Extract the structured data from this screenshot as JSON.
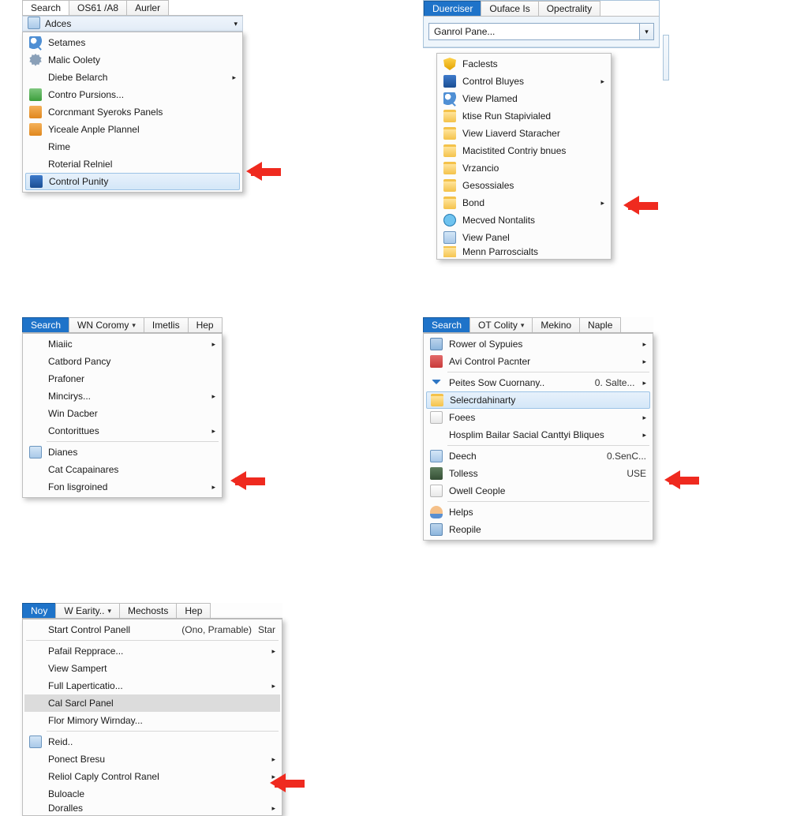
{
  "panel1": {
    "tabs": [
      "Search",
      "OS61 /A8",
      "Aurler"
    ],
    "subbar": {
      "label": "Adces"
    },
    "items": [
      {
        "label": "Setames",
        "icon": "search",
        "submenu": false
      },
      {
        "label": "Malic Oolety",
        "icon": "gear",
        "submenu": false
      },
      {
        "label": "Diebe Belarch",
        "icon": "",
        "submenu": true
      },
      {
        "label": "Contro Pursions...",
        "icon": "green",
        "submenu": false
      },
      {
        "label": "Corcnmant Syeroks Panels",
        "icon": "orange",
        "submenu": false
      },
      {
        "label": "Yiceale Anple Plannel",
        "icon": "orange",
        "submenu": false
      },
      {
        "label": "Rime",
        "icon": "",
        "submenu": false
      },
      {
        "label": "Roterial Relniel",
        "icon": "",
        "submenu": false
      },
      {
        "label": "Control Punity",
        "icon": "bluepc",
        "submenu": false,
        "highlight": "blue"
      }
    ]
  },
  "panel2": {
    "tabs": [
      "Duerciser",
      "Ouface Is",
      "Opectrality"
    ],
    "combo": "Ganrol Pane...",
    "items": [
      {
        "label": "Faclests",
        "icon": "shield",
        "submenu": false
      },
      {
        "label": "Control Bluyes",
        "icon": "bluepc",
        "submenu": true
      },
      {
        "label": "View Plamed",
        "icon": "search",
        "submenu": false
      },
      {
        "label": "ktise Run Stapivialed",
        "icon": "folder",
        "submenu": false
      },
      {
        "label": "View Liaverd Staracher",
        "icon": "folder",
        "submenu": false
      },
      {
        "label": "Macistited Contriy bnues",
        "icon": "folder",
        "submenu": false
      },
      {
        "label": "Vrzancio",
        "icon": "folder",
        "submenu": false
      },
      {
        "label": "Gesossiales",
        "icon": "folder",
        "submenu": false
      },
      {
        "label": "Bond",
        "icon": "folder",
        "submenu": true
      },
      {
        "label": "Mecved Nontalits",
        "icon": "globe",
        "submenu": false
      },
      {
        "label": "View Panel",
        "icon": "panel",
        "submenu": false
      },
      {
        "label": "Menn Parroscialts",
        "icon": "folder",
        "submenu": false
      }
    ]
  },
  "panel3": {
    "tabs": [
      "Search",
      "WN Coromy",
      "Imetlis",
      "Hep"
    ],
    "items": [
      {
        "label": "Miaiic",
        "submenu": true
      },
      {
        "label": "Catbord Pancy",
        "submenu": false
      },
      {
        "label": "Prafoner",
        "submenu": false
      },
      {
        "label": "Mincirys...",
        "submenu": true
      },
      {
        "label": "Win Dacber",
        "submenu": false
      },
      {
        "label": "Contorittues",
        "submenu": true
      },
      {
        "label": "Dianes",
        "submenu": false,
        "icon": "panel",
        "sep_before": true
      },
      {
        "label": "Cat Ccapainares",
        "submenu": false
      },
      {
        "label": "Fon lisgroined",
        "submenu": true
      }
    ]
  },
  "panel4": {
    "tabs": [
      "Search",
      "OT Colity",
      "Mekino",
      "Naple"
    ],
    "items": [
      {
        "label": "Rower ol Sypuies",
        "icon": "app",
        "submenu": true
      },
      {
        "label": "Avi Control Pacnter",
        "icon": "red",
        "submenu": true
      },
      {
        "label": "Peites Sow Cuornany..",
        "icon": "down",
        "right": "0. Salte...",
        "submenu": true,
        "sep_before": true
      },
      {
        "label": "Selecrdahinarty",
        "icon": "folder",
        "highlight": "blue"
      },
      {
        "label": "Foees",
        "icon": "doc",
        "submenu": true
      },
      {
        "label": "Hosplim Bailar Sacial Canttyi Bliques",
        "submenu": true
      },
      {
        "label": "Deech",
        "icon": "panel",
        "right": "0.SenC...",
        "sep_before": true
      },
      {
        "label": "Tolless",
        "icon": "darkg",
        "right": "USE"
      },
      {
        "label": "Owell Ceople",
        "icon": "doc",
        "sep_after": true
      },
      {
        "label": "Helps",
        "icon": "person"
      },
      {
        "label": "Reopile",
        "icon": "app"
      }
    ]
  },
  "panel5": {
    "tabs": [
      "Noy",
      "W Earity..",
      "Mechosts",
      "Hep"
    ],
    "title_row": {
      "label": "Start Control Panell",
      "right1": "(Ono, Pramable)",
      "right2": "Star"
    },
    "items": [
      {
        "label": "Pafail Repprace...",
        "submenu": true
      },
      {
        "label": "View Sampert"
      },
      {
        "label": "Full Laperticatio...",
        "submenu": true
      },
      {
        "label": "Cal Sarcl Panel",
        "highlight": "gray"
      },
      {
        "label": "Flor Mimory Wirnday..."
      },
      {
        "label": "Reid..",
        "icon": "panel",
        "sep_before": true
      },
      {
        "label": "Ponect Bresu",
        "submenu": true
      },
      {
        "label": "Reliol Caply Control Ranel",
        "submenu": true
      },
      {
        "label": "Buloacle"
      },
      {
        "label": "Doralles",
        "submenu": true
      }
    ]
  }
}
